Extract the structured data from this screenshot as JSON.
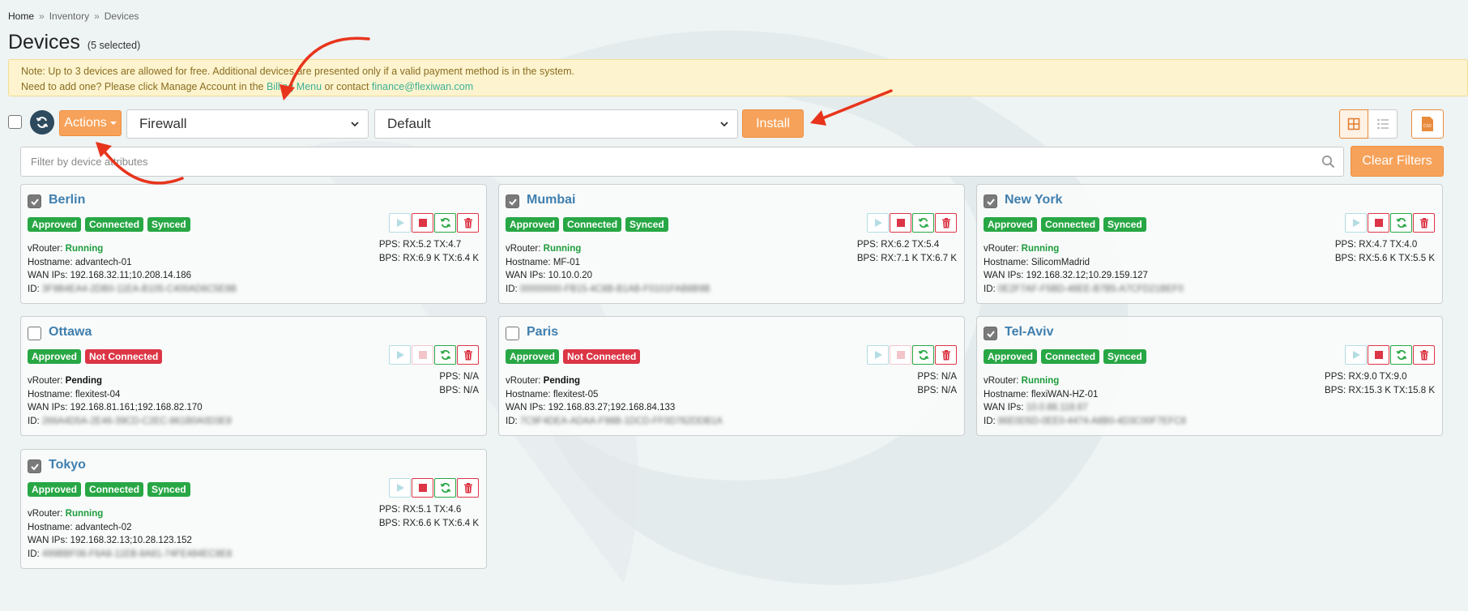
{
  "breadcrumb": [
    "Home",
    "Inventory",
    "Devices"
  ],
  "breadcrumb_sep": "»",
  "page": {
    "title": "Devices",
    "selected": "(5 selected)"
  },
  "note": {
    "line1": "Note: Up to 3 devices are allowed for free. Additional devices are presented only if a valid payment method is in the system.",
    "line2_before": "Need to add one? Please click Manage Account in the ",
    "billing_link": "Billing Menu",
    "line2_mid": " or contact ",
    "email": "finance@flexiwan.com"
  },
  "toolbar": {
    "actions_label": "Actions",
    "firewall_value": "Firewall",
    "default_value": "Default",
    "install_label": "Install",
    "csv_label": "CSV"
  },
  "filter": {
    "placeholder": "Filter by device attributes",
    "clear_label": "Clear Filters"
  },
  "labels": {
    "vrouter": "vRouter:",
    "hostname": "Hostname:",
    "wan": "WAN IPs:",
    "id": "ID:",
    "pps": "PPS:",
    "bps": "BPS:"
  },
  "devices": [
    {
      "name": "Berlin",
      "checked": true,
      "badges": [
        "Approved",
        "Connected",
        "Synced"
      ],
      "vrouter": "Running",
      "hostname": "advantech-01",
      "wan": "192.168.32.11;10.208.14.186",
      "id": "3F9B4EA4-2DB0-11EA-B105-C400AD6C5E8B",
      "pps": "RX:5.2 TX:4.7",
      "bps": "RX:6.9 K TX:6.4 K"
    },
    {
      "name": "Mumbai",
      "checked": true,
      "badges": [
        "Approved",
        "Connected",
        "Synced"
      ],
      "vrouter": "Running",
      "hostname": "MF-01",
      "wan": "10.10.0.20",
      "id": "00000000-FB15-4C8B-B1AB-F0101FAB8B9B",
      "pps": "RX:6.2 TX:5.4",
      "bps": "RX:7.1 K TX:6.7 K"
    },
    {
      "name": "New York",
      "checked": true,
      "badges": [
        "Approved",
        "Connected",
        "Synced"
      ],
      "vrouter": "Running",
      "hostname": "SilicomMadrid",
      "wan": "192.168.32.12;10.29.159.127",
      "id": "0E2F7AF-F5BD-48EE-B7B5-A7CFD21BEF0",
      "pps": "RX:4.7 TX:4.0",
      "bps": "RX:5.6 K TX:5.5 K"
    },
    {
      "name": "Ottawa",
      "checked": false,
      "badges": [
        "Approved",
        "Not Connected"
      ],
      "vrouter": "Pending",
      "hostname": "flexitest-04",
      "wan": "192.168.81.161;192.168.82.170",
      "id": "266A4D5A-2E46-39CD-C2EC-861B0A0D3E8",
      "pps": "N/A",
      "bps": "N/A"
    },
    {
      "name": "Paris",
      "checked": false,
      "badges": [
        "Approved",
        "Not Connected"
      ],
      "vrouter": "Pending",
      "hostname": "flexitest-05",
      "wan": "192.168.83.27;192.168.84.133",
      "id": "7C9F4DEA-ADAA-F98B-1DCD-FF0D762DDB1A",
      "pps": "N/A",
      "bps": "N/A"
    },
    {
      "name": "Tel-Aviv",
      "checked": true,
      "badges": [
        "Approved",
        "Connected",
        "Synced"
      ],
      "vrouter": "Running",
      "hostname": "flexiWAN-HZ-01",
      "wan": "10.0.88.118.67",
      "id": "86E0D5D-0EE0-4474-A8B0-4D3C00F7EFC8",
      "pps": "RX:9.0 TX:9.0",
      "bps": "RX:15.3 K TX:15.8 K"
    },
    {
      "name": "Tokyo",
      "checked": true,
      "badges": [
        "Approved",
        "Connected",
        "Synced"
      ],
      "vrouter": "Running",
      "hostname": "advantech-02",
      "wan": "192.168.32.13;10.28.123.152",
      "id": "499BBF06-F6A8-11EB-8A81-74FE484EC8E8",
      "pps": "RX:5.1 TX:4.6",
      "bps": "RX:6.6 K TX:6.4 K"
    }
  ],
  "colors": {
    "accent": "#f7a25a",
    "link": "#3f7fae",
    "success": "#28a745",
    "danger": "#dc3545",
    "annotation": "#e8341c"
  }
}
